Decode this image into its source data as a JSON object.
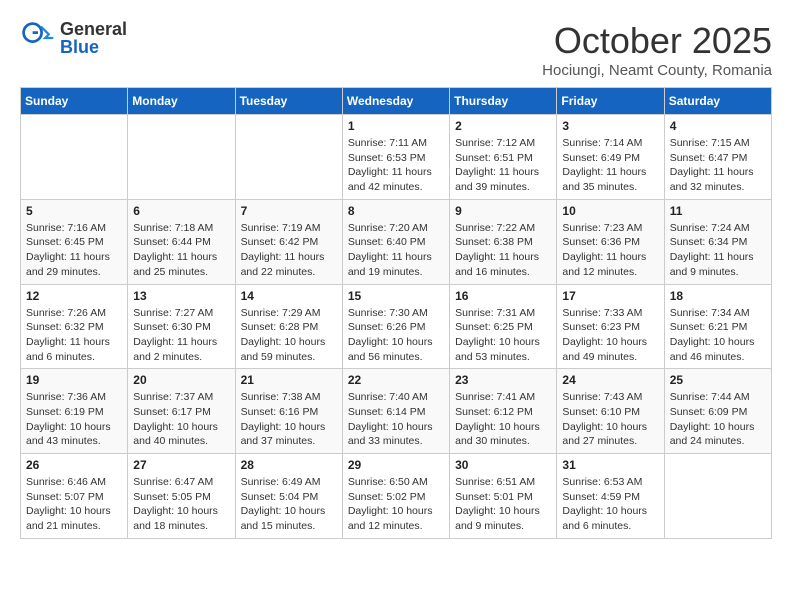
{
  "header": {
    "logo_general": "General",
    "logo_blue": "Blue",
    "month_title": "October 2025",
    "subtitle": "Hociungi, Neamt County, Romania"
  },
  "days_of_week": [
    "Sunday",
    "Monday",
    "Tuesday",
    "Wednesday",
    "Thursday",
    "Friday",
    "Saturday"
  ],
  "weeks": [
    [
      {
        "day": "",
        "content": ""
      },
      {
        "day": "",
        "content": ""
      },
      {
        "day": "",
        "content": ""
      },
      {
        "day": "1",
        "content": "Sunrise: 7:11 AM\nSunset: 6:53 PM\nDaylight: 11 hours and 42 minutes."
      },
      {
        "day": "2",
        "content": "Sunrise: 7:12 AM\nSunset: 6:51 PM\nDaylight: 11 hours and 39 minutes."
      },
      {
        "day": "3",
        "content": "Sunrise: 7:14 AM\nSunset: 6:49 PM\nDaylight: 11 hours and 35 minutes."
      },
      {
        "day": "4",
        "content": "Sunrise: 7:15 AM\nSunset: 6:47 PM\nDaylight: 11 hours and 32 minutes."
      }
    ],
    [
      {
        "day": "5",
        "content": "Sunrise: 7:16 AM\nSunset: 6:45 PM\nDaylight: 11 hours and 29 minutes."
      },
      {
        "day": "6",
        "content": "Sunrise: 7:18 AM\nSunset: 6:44 PM\nDaylight: 11 hours and 25 minutes."
      },
      {
        "day": "7",
        "content": "Sunrise: 7:19 AM\nSunset: 6:42 PM\nDaylight: 11 hours and 22 minutes."
      },
      {
        "day": "8",
        "content": "Sunrise: 7:20 AM\nSunset: 6:40 PM\nDaylight: 11 hours and 19 minutes."
      },
      {
        "day": "9",
        "content": "Sunrise: 7:22 AM\nSunset: 6:38 PM\nDaylight: 11 hours and 16 minutes."
      },
      {
        "day": "10",
        "content": "Sunrise: 7:23 AM\nSunset: 6:36 PM\nDaylight: 11 hours and 12 minutes."
      },
      {
        "day": "11",
        "content": "Sunrise: 7:24 AM\nSunset: 6:34 PM\nDaylight: 11 hours and 9 minutes."
      }
    ],
    [
      {
        "day": "12",
        "content": "Sunrise: 7:26 AM\nSunset: 6:32 PM\nDaylight: 11 hours and 6 minutes."
      },
      {
        "day": "13",
        "content": "Sunrise: 7:27 AM\nSunset: 6:30 PM\nDaylight: 11 hours and 2 minutes."
      },
      {
        "day": "14",
        "content": "Sunrise: 7:29 AM\nSunset: 6:28 PM\nDaylight: 10 hours and 59 minutes."
      },
      {
        "day": "15",
        "content": "Sunrise: 7:30 AM\nSunset: 6:26 PM\nDaylight: 10 hours and 56 minutes."
      },
      {
        "day": "16",
        "content": "Sunrise: 7:31 AM\nSunset: 6:25 PM\nDaylight: 10 hours and 53 minutes."
      },
      {
        "day": "17",
        "content": "Sunrise: 7:33 AM\nSunset: 6:23 PM\nDaylight: 10 hours and 49 minutes."
      },
      {
        "day": "18",
        "content": "Sunrise: 7:34 AM\nSunset: 6:21 PM\nDaylight: 10 hours and 46 minutes."
      }
    ],
    [
      {
        "day": "19",
        "content": "Sunrise: 7:36 AM\nSunset: 6:19 PM\nDaylight: 10 hours and 43 minutes."
      },
      {
        "day": "20",
        "content": "Sunrise: 7:37 AM\nSunset: 6:17 PM\nDaylight: 10 hours and 40 minutes."
      },
      {
        "day": "21",
        "content": "Sunrise: 7:38 AM\nSunset: 6:16 PM\nDaylight: 10 hours and 37 minutes."
      },
      {
        "day": "22",
        "content": "Sunrise: 7:40 AM\nSunset: 6:14 PM\nDaylight: 10 hours and 33 minutes."
      },
      {
        "day": "23",
        "content": "Sunrise: 7:41 AM\nSunset: 6:12 PM\nDaylight: 10 hours and 30 minutes."
      },
      {
        "day": "24",
        "content": "Sunrise: 7:43 AM\nSunset: 6:10 PM\nDaylight: 10 hours and 27 minutes."
      },
      {
        "day": "25",
        "content": "Sunrise: 7:44 AM\nSunset: 6:09 PM\nDaylight: 10 hours and 24 minutes."
      }
    ],
    [
      {
        "day": "26",
        "content": "Sunrise: 6:46 AM\nSunset: 5:07 PM\nDaylight: 10 hours and 21 minutes."
      },
      {
        "day": "27",
        "content": "Sunrise: 6:47 AM\nSunset: 5:05 PM\nDaylight: 10 hours and 18 minutes."
      },
      {
        "day": "28",
        "content": "Sunrise: 6:49 AM\nSunset: 5:04 PM\nDaylight: 10 hours and 15 minutes."
      },
      {
        "day": "29",
        "content": "Sunrise: 6:50 AM\nSunset: 5:02 PM\nDaylight: 10 hours and 12 minutes."
      },
      {
        "day": "30",
        "content": "Sunrise: 6:51 AM\nSunset: 5:01 PM\nDaylight: 10 hours and 9 minutes."
      },
      {
        "day": "31",
        "content": "Sunrise: 6:53 AM\nSunset: 4:59 PM\nDaylight: 10 hours and 6 minutes."
      },
      {
        "day": "",
        "content": ""
      }
    ]
  ]
}
